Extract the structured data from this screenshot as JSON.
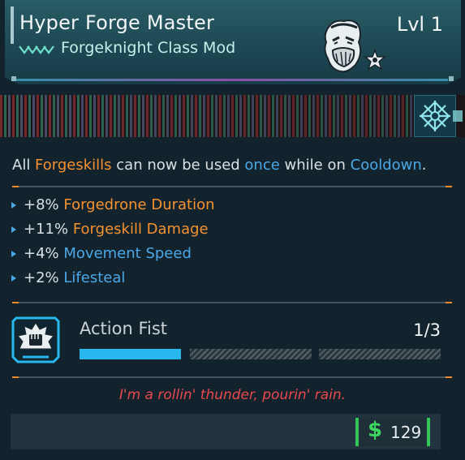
{
  "item": {
    "name": "Hyper Forge Master",
    "type": "Forgeknight Class Mod",
    "level": "Lvl 1",
    "rarity_icon": "chevrons-rarity-icon",
    "portrait_icon": "bearded-knight-portrait-icon",
    "element_icon": "cryo-snowflake-icon"
  },
  "description": {
    "p1": "All ",
    "h1": "Forgeskills",
    "p2": " can now be used ",
    "h2": "once",
    "p3": " while on ",
    "h3": "Cooldown",
    "p4": "."
  },
  "stats": [
    {
      "value": "+8%",
      "label": "Forgedrone Duration",
      "color": "#f5922f"
    },
    {
      "value": "+11%",
      "label": "Forgeskill Damage",
      "color": "#f5922f"
    },
    {
      "value": "+4%",
      "label": "Movement Speed",
      "color": "#4aa8e8"
    },
    {
      "value": "+2%",
      "label": "Lifesteal",
      "color": "#4aa8e8"
    }
  ],
  "skill": {
    "name": "Action Fist",
    "rank": "1/3",
    "rank_current": 1,
    "rank_max": 3,
    "icon": "fist-skill-icon"
  },
  "flavor": "I'm a rollin' thunder, pourin' rain.",
  "price": {
    "symbol": "$",
    "value": "129"
  },
  "colors": {
    "accent_orange": "#f5922f",
    "accent_blue": "#4aa8e8",
    "flavor_red": "#e8484d",
    "price_green": "#3cd560",
    "rank_fill": "#29b8ee"
  }
}
